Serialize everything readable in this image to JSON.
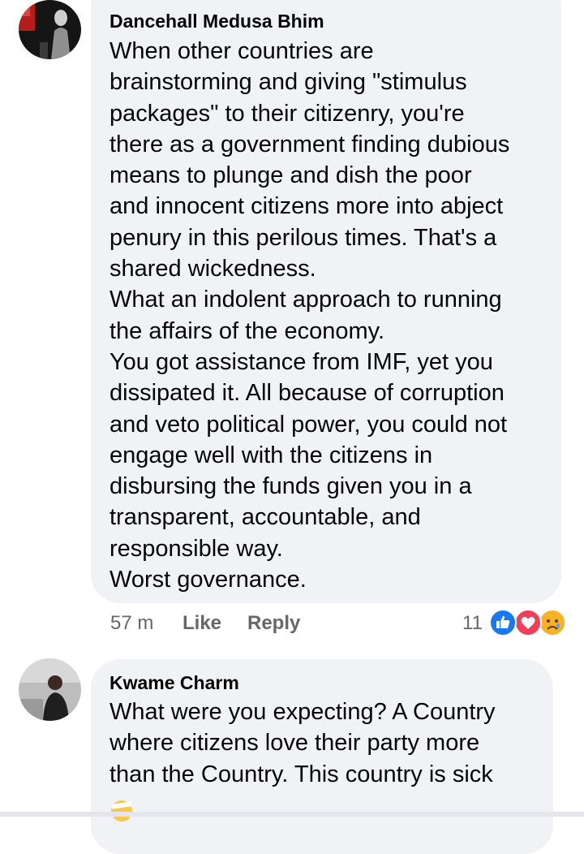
{
  "comments": [
    {
      "author": "Dancehall Medusa Bhim",
      "lines": [
        "When other countries are",
        "brainstorming and giving \"stimulus",
        "packages\" to their citizenry, you're",
        "there as a government finding dubious",
        "means to plunge and dish the poor",
        "and innocent citizens more into abject",
        "penury in this perilous times. That's a",
        "shared wickedness.",
        "What an indolent approach to running",
        "the affairs of the economy.",
        "You got assistance from IMF, yet you",
        "dissipated it. All because of corruption",
        "and veto political power, you could not",
        "engage well with the citizens in",
        "disbursing the funds given you in a",
        "transparent, accountable, and",
        "responsible way.",
        "Worst governance."
      ],
      "time": "57 m",
      "like_label": "Like",
      "reply_label": "Reply",
      "reaction_count": "11",
      "reactions": [
        "like-icon",
        "love-icon",
        "sad-icon"
      ]
    },
    {
      "author": "Kwame Charm",
      "lines": [
        "What were you expecting? A Country",
        "where citizens love their party more",
        "than the Country.  This country is sick"
      ],
      "trailing_emoji": "face-with-head-bandage-icon"
    }
  ],
  "colors": {
    "bubble": "#f0f2f5",
    "meta_text": "#65676b",
    "like_blue": "#1877f2",
    "love_red": "#f33e58",
    "sad_yellow": "#f7b125"
  }
}
